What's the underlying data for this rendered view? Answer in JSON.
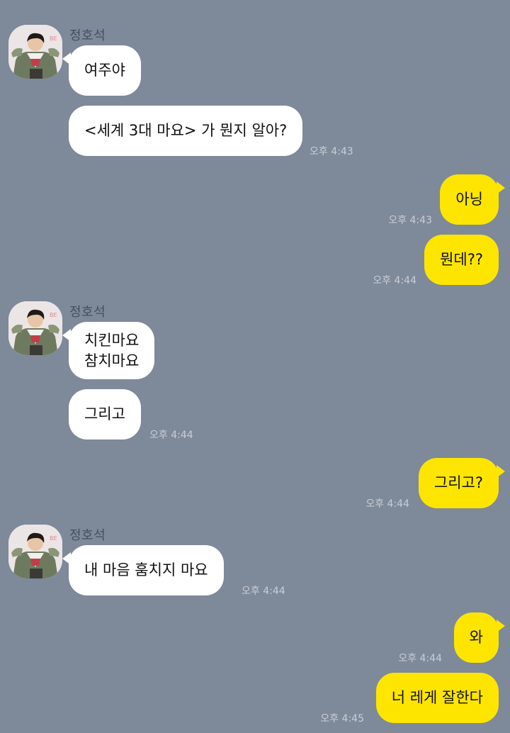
{
  "colors": {
    "background": "#7e899a",
    "incoming_bubble": "#ffffff",
    "outgoing_bubble": "#fee500",
    "timestamp": "#c9ced6",
    "sender_name": "#454e5b"
  },
  "messages": [
    {
      "side": "in",
      "sender": "정호석",
      "lines": [
        "여주야"
      ]
    },
    {
      "side": "in",
      "lines": [
        "<세계 3대 마요> 가 뭔지 알아?"
      ],
      "time": "오후 4:43"
    },
    {
      "side": "out",
      "lines": [
        "아닝"
      ],
      "time": "오후 4:43"
    },
    {
      "side": "out",
      "lines": [
        "뭔데??"
      ],
      "time": "오후 4:44"
    },
    {
      "side": "in",
      "sender": "정호석",
      "lines": [
        "치킨마요",
        "참치마요"
      ]
    },
    {
      "side": "in",
      "lines": [
        "그리고"
      ],
      "time": "오후 4:44"
    },
    {
      "side": "out",
      "lines": [
        "그리고?"
      ],
      "time": "오후 4:44"
    },
    {
      "side": "in",
      "sender": "정호석",
      "lines": [
        "내 마음 훔치지 마요"
      ],
      "time": "오후 4:44"
    },
    {
      "side": "out",
      "lines": [
        "와"
      ],
      "time": "오후 4:44"
    },
    {
      "side": "out",
      "lines": [
        "너 레게 잘한다"
      ],
      "time": "오후 4:45"
    }
  ]
}
